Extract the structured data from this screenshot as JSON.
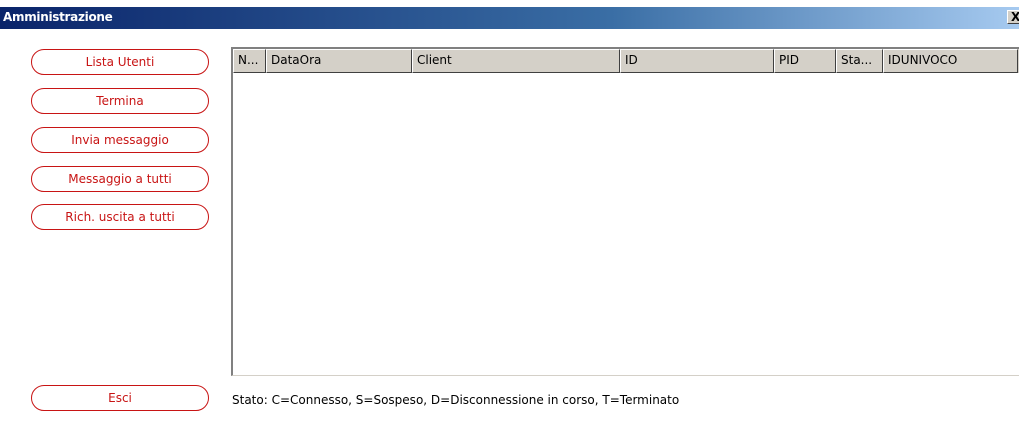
{
  "window": {
    "title": "Amministrazione",
    "close_label": "X"
  },
  "buttons": {
    "lista_utenti": "Lista Utenti",
    "termina": "Termina",
    "invia_messaggio": "Invia messaggio",
    "messaggio_a_tutti": "Messaggio a tutti",
    "rich_uscita_a_tutti": "Rich. uscita a tutti",
    "esci": "Esci"
  },
  "grid": {
    "columns": [
      "N...",
      "DataOra",
      "Client",
      "ID",
      "PID",
      "Sta...",
      "IDUNIVOCO"
    ],
    "rows": []
  },
  "status_text": "Stato: C=Connesso, S=Sospeso, D=Disconnessione in corso, T=Terminato",
  "colors": {
    "accent": "#c81414",
    "title_bar_start": "#0a246a",
    "title_bar_end": "#a6caf0",
    "header_bg": "#d4d0c8"
  }
}
